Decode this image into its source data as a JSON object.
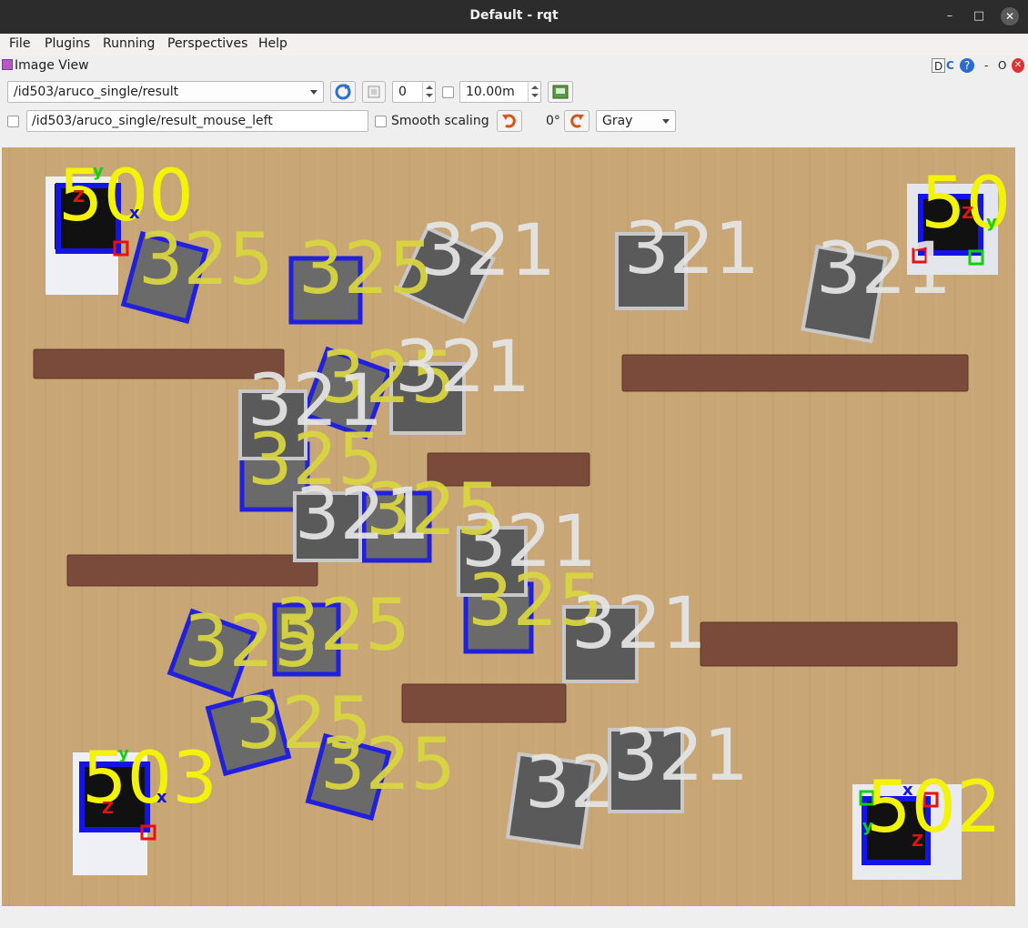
{
  "window": {
    "title": "Default - rqt",
    "minimize": "–",
    "maximize": "□",
    "close": "✕"
  },
  "menu": [
    "File",
    "Plugins",
    "Running",
    "Perspectives",
    "Help"
  ],
  "plugin": {
    "title": "Image View",
    "controls": [
      "D",
      "C",
      "?",
      "-",
      "O"
    ]
  },
  "toolbar1": {
    "topic": "/id503/aruco_single/result",
    "rotation_spin": "0",
    "max_range": "10.00m",
    "refresh_icon": "refresh-icon",
    "zoom_icon": "zoom-fit-icon",
    "save_icon": "save-image-icon"
  },
  "toolbar2": {
    "publish_topic": "/id503/aruco_single/result_mouse_left",
    "smooth_label": "Smooth scaling",
    "rotation_label": "0°",
    "color_scheme": "Gray"
  },
  "markers": [
    {
      "id": "500"
    },
    {
      "id": "50"
    },
    {
      "id": "503"
    },
    {
      "id": "502"
    },
    {
      "id": "325"
    },
    {
      "id": "321"
    },
    {
      "id": "32"
    }
  ]
}
